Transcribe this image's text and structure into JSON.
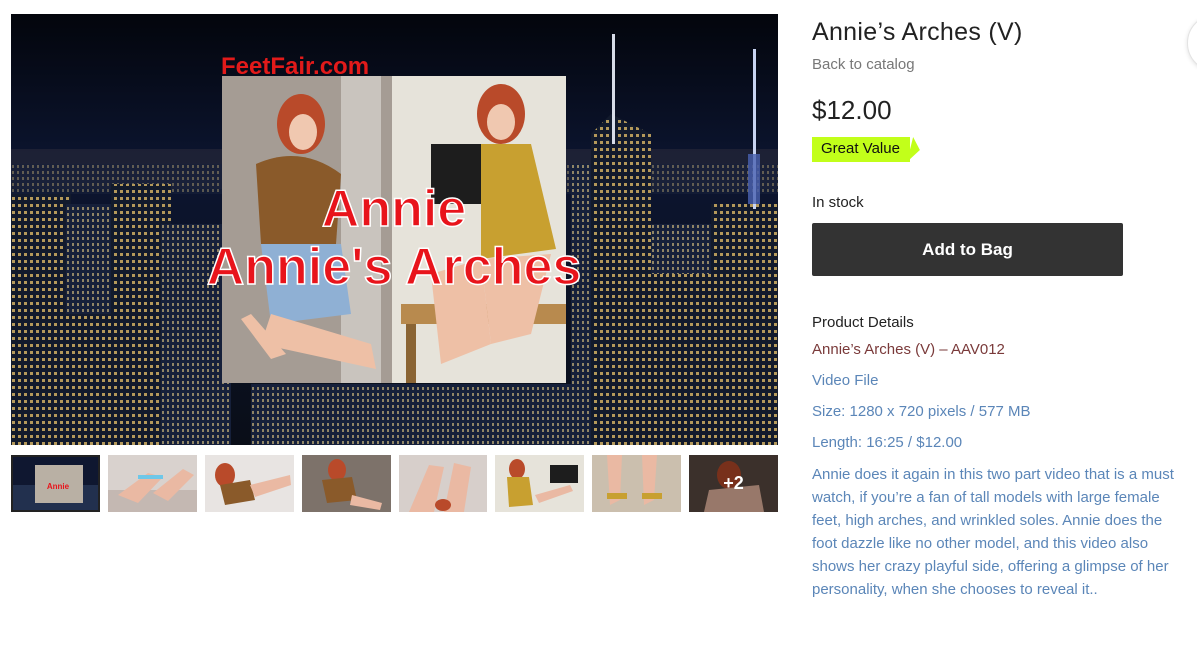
{
  "gallery": {
    "main_image": {
      "brand_text": "FeetFair.com",
      "title_line1": "Annie",
      "title_line2": "Annie's Arches"
    },
    "thumbnails": [
      {
        "name": "thumb-1"
      },
      {
        "name": "thumb-2"
      },
      {
        "name": "thumb-3"
      },
      {
        "name": "thumb-4"
      },
      {
        "name": "thumb-5"
      },
      {
        "name": "thumb-6"
      },
      {
        "name": "thumb-7"
      },
      {
        "name": "thumb-8"
      }
    ],
    "more_label": "+2"
  },
  "product": {
    "title": "Annie’s Arches (V)",
    "back_link": "Back to catalog",
    "price": "$12.00",
    "ribbon": "Great Value",
    "stock": "In stock",
    "add_to_bag": "Add to Bag",
    "details_heading": "Product Details",
    "details_subtitle": "Annie’s Arches (V) – AAV012",
    "details_lines": [
      "Video File",
      "Size: 1280 x 720 pixels / 577 MB",
      "Length: 16:25 / $12.00"
    ],
    "description": "Annie does it again in this two part video that is a must watch, if you’re a fan of tall models with large female feet, high arches, and wrinkled soles. Annie does the foot dazzle like no other model, and this video also shows her crazy playful side, offering a glimpse of her personality, when she chooses to reveal it.."
  },
  "colors": {
    "ribbon": "#c2ff1a",
    "button": "#333333",
    "link_blue": "#5b86b8",
    "subtitle_red": "#7a3a3a"
  }
}
